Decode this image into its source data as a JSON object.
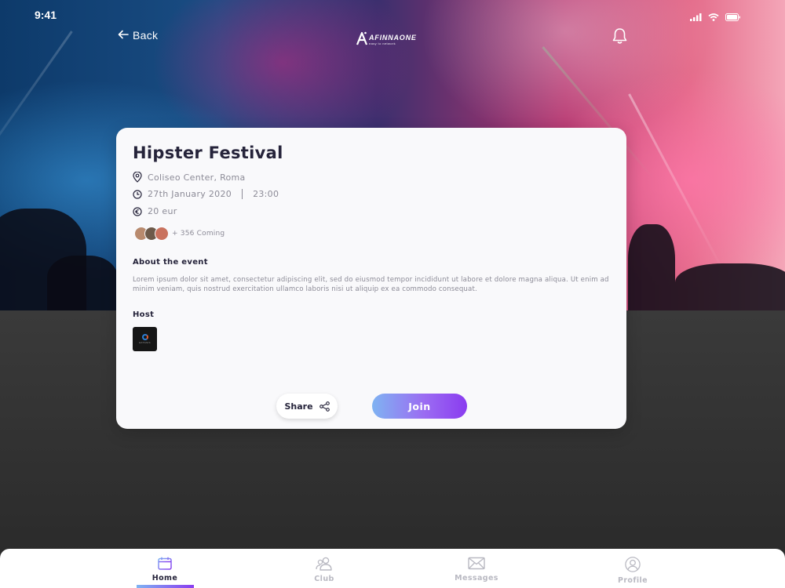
{
  "status_bar": {
    "time": "9:41"
  },
  "header": {
    "back_label": "Back",
    "logo_text": "AFINNAONE",
    "logo_tagline": "easy to network"
  },
  "event": {
    "title": "Hipster Festival",
    "location": "Coliseo Center, Roma",
    "date": "27th January 2020",
    "time": "23:00",
    "price": "20 eur",
    "attendees_label": "+ 356 Coming",
    "attendee_avatar_colors": [
      "#b88a6e",
      "#6d5a4a",
      "#c9725e"
    ]
  },
  "about": {
    "title": "About the event",
    "text": "Lorem ipsum dolor sit amet, consectetur adipiscing elit, sed do eiusmod tempor incididunt ut labore et dolore magna aliqua. Ut enim ad minim veniam, quis nostrud exercitation ullamco laboris nisi ut aliquip ex ea commodo consequat."
  },
  "host": {
    "title": "Host",
    "logo_text": "EXTASIS"
  },
  "actions": {
    "share_label": "Share",
    "join_label": "Join"
  },
  "tabs": [
    {
      "label": "Home",
      "icon": "calendar-icon",
      "active": true
    },
    {
      "label": "Club",
      "icon": "users-icon",
      "active": false
    },
    {
      "label": "Messages",
      "icon": "envelope-icon",
      "active": false
    },
    {
      "label": "Profile",
      "icon": "user-circle-icon",
      "active": false
    }
  ],
  "colors": {
    "accent_start": "#7fb3f2",
    "accent_end": "#8a3cf0",
    "title_text": "#25233a",
    "muted_text": "#8c8b97"
  }
}
